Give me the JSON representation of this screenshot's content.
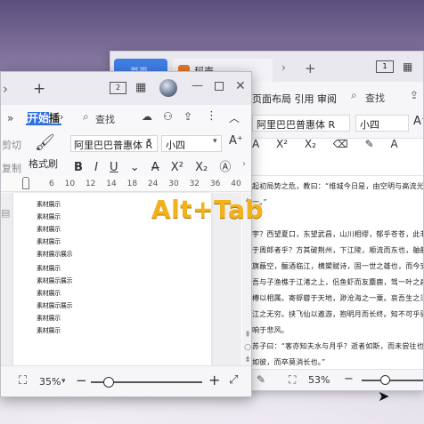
{
  "back_window": {
    "tab_active": "首页",
    "tab_doc": "稻壳",
    "menu_tabs": "页面布局 引用 审阅",
    "search_label": "查找",
    "font_name": "阿里巴巴普惠体 R",
    "font_size": "小四",
    "doc_lines": [
      "起初局势之危，教曰：“维城今日是，由空明与高流光，秒帮千",
      "一。”",
      "宇？西望夏口，东望武昌，山川相缪，郁乎苍苍，此非孟德之困",
      "于周郎者乎？方其破荆州，下江陵，顺流而东也，舳舻千里，旌",
      "旗蔽空，酾酒临江，横槊赋诗，固一世之雄也，而今安在哉？况",
      "吾与子渔樵于江渚之上，侣鱼虾而友麋鹿，驾一叶之扁舟，举匏",
      "樽以相属。寄蜉蝣于天地，渺沧海之一粟。哀吾生之须臾，羡长",
      "江之无穷。挟飞仙以遨游，抱明月而长终。知不可乎骤得，托遗",
      "响于悲风。",
      "苏子曰：“客亦知夫水与月乎？逝者如斯，而未尝往也；盈虚者",
      "如彼，而卒莫消长也。”"
    ],
    "zoom": "53%"
  },
  "front_window": {
    "tab_start": "开始",
    "tab_insert": "插",
    "search_label": "查找",
    "cut_label": "剪切",
    "copy_label": "复制",
    "format_painter_label": "格式刷",
    "font_name": "阿里巴巴普惠体 R",
    "font_size": "小四",
    "ruler_numbers": [
      "6",
      "8",
      "10",
      "12",
      "14",
      "16",
      "18",
      "20",
      "22",
      "24",
      "26",
      "28",
      "30",
      "32",
      "34",
      "36",
      "38",
      "40"
    ],
    "layout_label": "2",
    "doc_lines": [
      "素材展示",
      "素材展示",
      "素材展示",
      "素材展示",
      "素材展示展示",
      "素材展示",
      "素材展示展示",
      "素材展示",
      "素材展示展示",
      "素材展示",
      "素材展示"
    ],
    "zoom": "35%"
  },
  "overlay": {
    "shortcut_label": "Alt+Tab"
  },
  "colors": {
    "accent": "#2f6fe0",
    "overlay_text": "#f3b21c"
  }
}
